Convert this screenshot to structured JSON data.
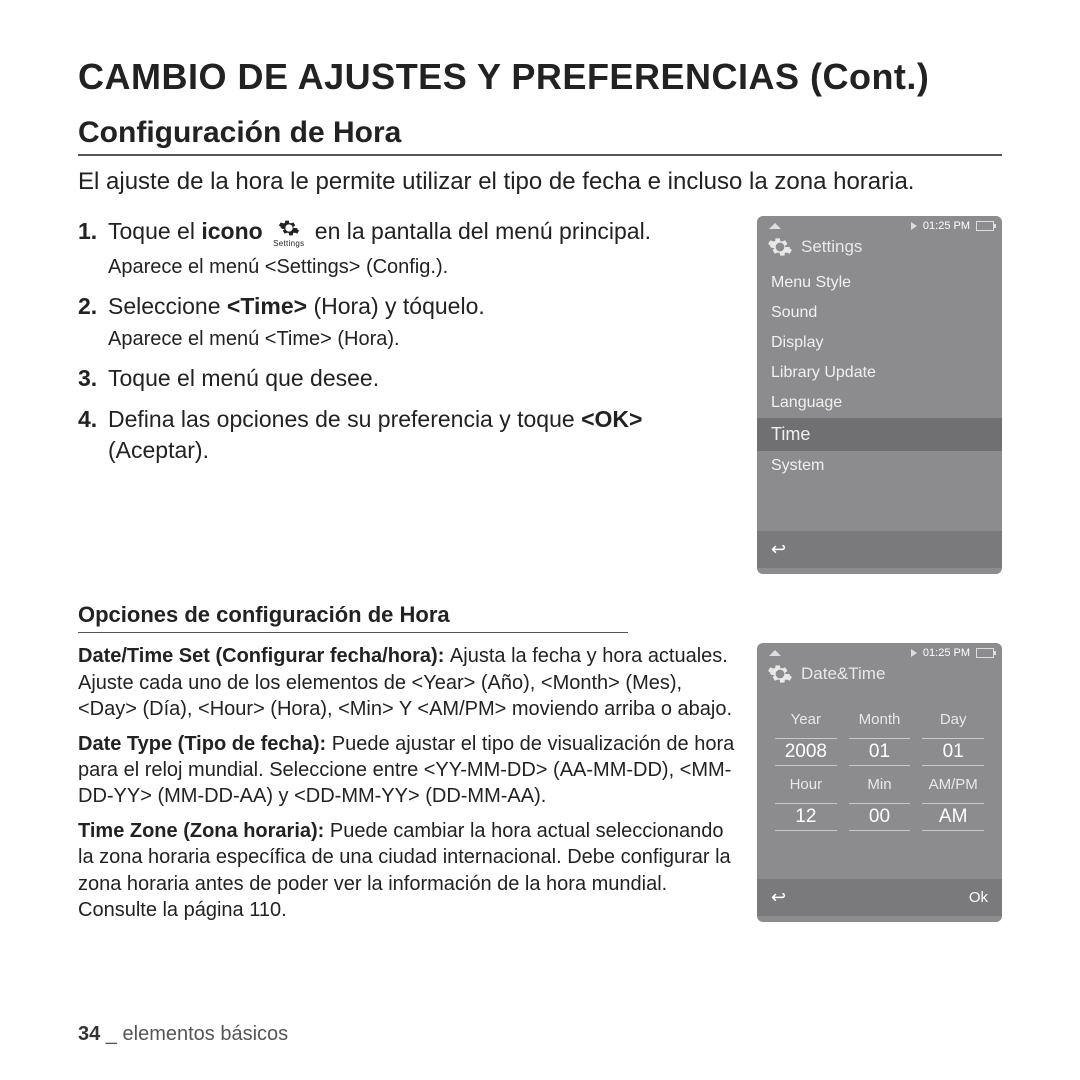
{
  "page_title": "CAMBIO DE AJUSTES Y PREFERENCIAS (Cont.)",
  "section_title": "Conﬁguración de Hora",
  "intro": "El ajuste de la hora le permite utilizar el tipo de fecha e incluso la zona horaria.",
  "steps": {
    "s1a": "Toque el ",
    "s1b": "icono",
    "s1c": " en la pantalla del menú principal.",
    "s1_sub": "Aparece el menú <Settings> (Conﬁg.).",
    "s2a": "Seleccione ",
    "s2b": "<Time>",
    "s2c": " (Hora) y tóquelo.",
    "s2_sub": "Aparece el menú <Time> (Hora).",
    "s3": "Toque el menú que desee.",
    "s4a": "Deﬁna las opciones de su preferencia y toque ",
    "s4b": "<OK>",
    "s4c": " (Aceptar)."
  },
  "gear_label": "Settings",
  "phone1": {
    "time": "01:25 PM",
    "title": "Settings",
    "items": [
      "Menu Style",
      "Sound",
      "Display",
      "Library Update",
      "Language",
      "Time",
      "System"
    ],
    "selected_index": 5
  },
  "phone2": {
    "time": "01:25 PM",
    "title": "Date&Time",
    "labels": {
      "year": "Year",
      "month": "Month",
      "day": "Day",
      "hour": "Hour",
      "min": "Min",
      "ampm": "AM/PM"
    },
    "values": {
      "year": "2008",
      "month": "01",
      "day": "01",
      "hour": "12",
      "min": "00",
      "ampm": "AM"
    },
    "ok": "Ok"
  },
  "options_title": "Opciones de conﬁguración de Hora",
  "opt1_label": "Date/Time Set (Conﬁgurar fecha/hora): ",
  "opt1_body": "Ajusta la fecha y hora actuales. Ajuste cada uno de los elementos de <Year> (Año), <Month> (Mes), <Day> (Día), <Hour> (Hora), <Min> Y <AM/PM> moviendo arriba o abajo.",
  "opt2_label": "Date Type (Tipo de fecha): ",
  "opt2_body": "Puede ajustar el tipo de visualización de hora para el reloj mundial. Seleccione entre <YY-MM-DD> (AA-MM-DD), <MM-DD-YY> (MM-DD-AA) y <DD-MM-YY> (DD-MM-AA).",
  "opt3_label": "Time Zone (Zona horaria): ",
  "opt3_body": "Puede cambiar la hora actual seleccionando la zona horaria especíﬁca de una ciudad internacional. Debe conﬁgurar la zona horaria antes de poder ver la información de la hora mundial. Consulte la página 110.",
  "footer_page": "34",
  "footer_sep": " _ ",
  "footer_text": "elementos básicos"
}
